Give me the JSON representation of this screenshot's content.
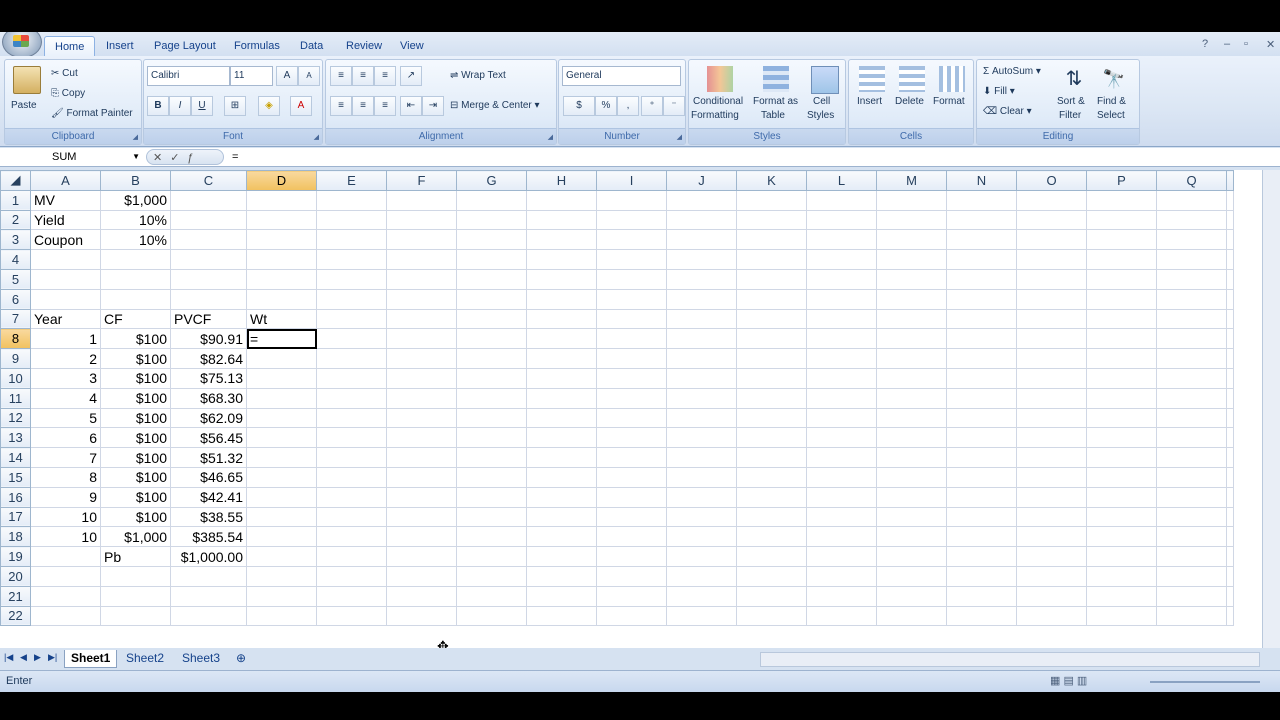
{
  "ribbon": {
    "tabs": [
      "Home",
      "Insert",
      "Page Layout",
      "Formulas",
      "Data",
      "Review",
      "View"
    ],
    "clipboard": {
      "label": "Clipboard",
      "paste": "Paste",
      "cut": "Cut",
      "copy": "Copy",
      "format_painter": "Format Painter"
    },
    "font": {
      "label": "Font",
      "name": "Calibri",
      "size": "11",
      "bold": "B",
      "italic": "I",
      "underline": "U",
      "grow": "A",
      "shrink": "A"
    },
    "alignment": {
      "label": "Alignment",
      "wrap": "Wrap Text",
      "merge": "Merge & Center"
    },
    "number": {
      "label": "Number",
      "format": "General",
      "currency": "$",
      "percent": "%",
      "comma": ","
    },
    "styles": {
      "label": "Styles",
      "conditional": "Conditional",
      "conditional2": "Formatting",
      "format_as": "Format as",
      "format_as2": "Table",
      "cell": "Cell",
      "cell2": "Styles"
    },
    "cells": {
      "label": "Cells",
      "insert": "Insert",
      "delete": "Delete",
      "format": "Format"
    },
    "editing": {
      "label": "Editing",
      "autosum": "AutoSum",
      "fill": "Fill",
      "clear": "Clear",
      "sort": "Sort &",
      "sort2": "Filter",
      "find": "Find &",
      "find2": "Select"
    }
  },
  "formula_bar": {
    "name_box": "SUM",
    "content": "="
  },
  "grid": {
    "columns": [
      "A",
      "B",
      "C",
      "D",
      "E",
      "F",
      "G",
      "H",
      "I",
      "J",
      "K",
      "L",
      "M",
      "N",
      "O",
      "P",
      "Q"
    ],
    "rows": [
      [
        "1",
        "MV",
        "$1,000",
        "",
        ""
      ],
      [
        "2",
        "Yield",
        "10%",
        "",
        ""
      ],
      [
        "3",
        "Coupon",
        "10%",
        "",
        ""
      ],
      [
        "4",
        "",
        "",
        "",
        ""
      ],
      [
        "5",
        "",
        "",
        "",
        ""
      ],
      [
        "6",
        "",
        "",
        "",
        ""
      ],
      [
        "7",
        "Year",
        "CF",
        "PVCF",
        "Wt"
      ],
      [
        "8",
        "1",
        "$100",
        "$90.91",
        "="
      ],
      [
        "9",
        "2",
        "$100",
        "$82.64",
        ""
      ],
      [
        "10",
        "3",
        "$100",
        "$75.13",
        ""
      ],
      [
        "11",
        "4",
        "$100",
        "$68.30",
        ""
      ],
      [
        "12",
        "5",
        "$100",
        "$62.09",
        ""
      ],
      [
        "13",
        "6",
        "$100",
        "$56.45",
        ""
      ],
      [
        "14",
        "7",
        "$100",
        "$51.32",
        ""
      ],
      [
        "15",
        "8",
        "$100",
        "$46.65",
        ""
      ],
      [
        "16",
        "9",
        "$100",
        "$42.41",
        ""
      ],
      [
        "17",
        "10",
        "$100",
        "$38.55",
        ""
      ],
      [
        "18",
        "10",
        "$1,000",
        "$385.54",
        ""
      ],
      [
        "19",
        "",
        "Pb",
        "$1,000.00",
        ""
      ],
      [
        "20",
        "",
        "",
        "",
        ""
      ],
      [
        "21",
        "",
        "",
        "",
        ""
      ],
      [
        "22",
        "",
        "",
        "",
        ""
      ]
    ]
  },
  "sheets": [
    "Sheet1",
    "Sheet2",
    "Sheet3"
  ],
  "status": {
    "mode": "Enter"
  }
}
